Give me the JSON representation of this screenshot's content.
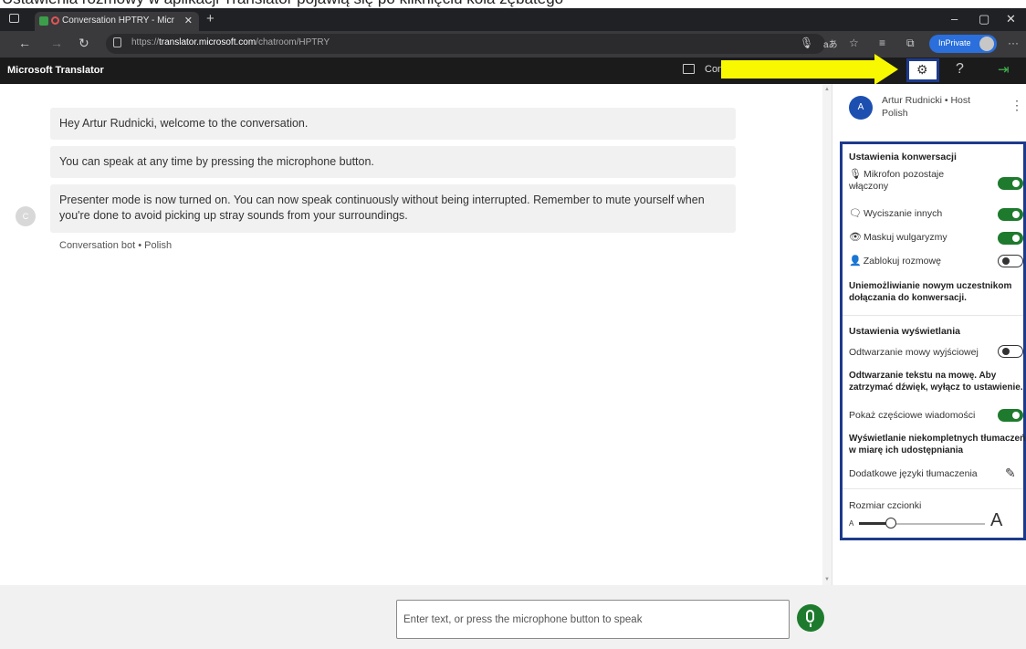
{
  "caption": "Ustawienia rozmowy w aplikacji Translator pojawią się po kliknięciu koła zębatego",
  "browser": {
    "tab_title": "Conversation HPTRY - Micr",
    "url_prefix": "https://",
    "url_host": "translator.microsoft.com",
    "url_path": "/chatroom/HPTRY",
    "inprivate_label": "InPrivate"
  },
  "appbar": {
    "title": "Microsoft Translator",
    "conversation_label": "Con"
  },
  "chat": {
    "messages": [
      "Hey Artur Rudnicki, welcome to the conversation.",
      "You can speak at any time by pressing the microphone button.",
      "Presenter mode is now turned on. You can now speak continuously without being interrupted. Remember to mute yourself when you're done to avoid picking up stray sounds from your surroundings."
    ],
    "bot_avatar_letter": "C",
    "bot_meta": "Conversation bot • Polish"
  },
  "user": {
    "avatar_letter": "A",
    "name_line": "Artur Rudnicki • Host",
    "language": "Polish"
  },
  "settings": {
    "conversation_title": "Ustawienia konwersacji",
    "mic_label": "Mikrofon pozostaje włączony",
    "mute_label": "Wyciszanie innych",
    "profanity_label": "Maskuj wulgaryzmy",
    "lock_label": "Zablokuj rozmowę",
    "lock_desc": "Uniemożliwianie nowym uczestnikom dołączania do konwersacji.",
    "display_title": "Ustawienia wyświetlania",
    "tts_label": "Odtwarzanie mowy wyjściowej",
    "tts_desc": "Odtwarzanie tekstu na mowę. Aby zatrzymać dźwięk, wyłącz to ustawienie.",
    "partial_label": "Pokaż częściowe wiadomości",
    "partial_desc": "Wyświetlanie niekompletnych tłumaczeń w miarę ich udostępniania",
    "extra_lang_label": "Dodatkowe języki tłumaczenia",
    "font_size_title": "Rozmiar czcionki",
    "font_small": "A",
    "font_large": "A",
    "font_size_level": 0.25,
    "toggles": {
      "mic": true,
      "mute_others": true,
      "profanity": true,
      "lock": false,
      "tts": false,
      "partial": true
    }
  },
  "input": {
    "placeholder": "Enter text, or press the microphone button to speak"
  },
  "colors": {
    "accent_green": "#1e7b2d",
    "highlight_border": "#1d3b8c",
    "arrow_yellow": "#f8f800",
    "avatar_blue": "#1c4fb0"
  }
}
